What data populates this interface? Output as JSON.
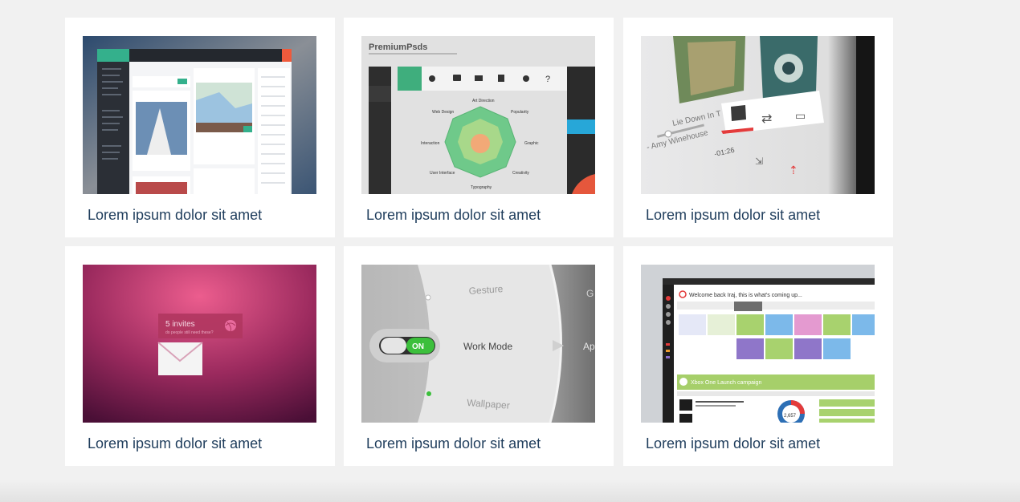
{
  "gallery": {
    "items": [
      {
        "title": "Lorem ipsum dolor sit amet",
        "image": "social-dashboard-ui"
      },
      {
        "title": "Lorem ipsum dolor sit amet",
        "image": "premiumpsds-radar-dashboard"
      },
      {
        "title": "Lorem ipsum dolor sit amet",
        "image": "music-player-ui"
      },
      {
        "title": "Lorem ipsum dolor sit amet",
        "image": "dribbble-invites-envelope"
      },
      {
        "title": "Lorem ipsum dolor sit amet",
        "image": "work-mode-toggle-dial"
      },
      {
        "title": "Lorem ipsum dolor sit amet",
        "image": "calendar-campaign-dashboard"
      }
    ]
  },
  "thumb_text": {
    "premium_brand": "PremiumPsds",
    "radar_labels": [
      "Art Direction",
      "Popularity",
      "Graphic",
      "Creativity",
      "Typography",
      "User Interface",
      "Interaction",
      "Web Design"
    ],
    "music_track": "Lie Down In T",
    "music_artist": "- Amy Winehouse",
    "music_time": "-01:26",
    "invites_title": "5 invites",
    "invites_sub": "do people still need these?",
    "dial_gesture": "Gesture",
    "dial_work_mode": "Work Mode",
    "dial_wallpaper": "Wallpaper",
    "dial_toggle": "ON",
    "calendar_welcome": "Welcome back Iraj, this is what's coming up...",
    "calendar_campaign": "Xbox One Launch campaign",
    "calendar_stat": "2,657"
  }
}
